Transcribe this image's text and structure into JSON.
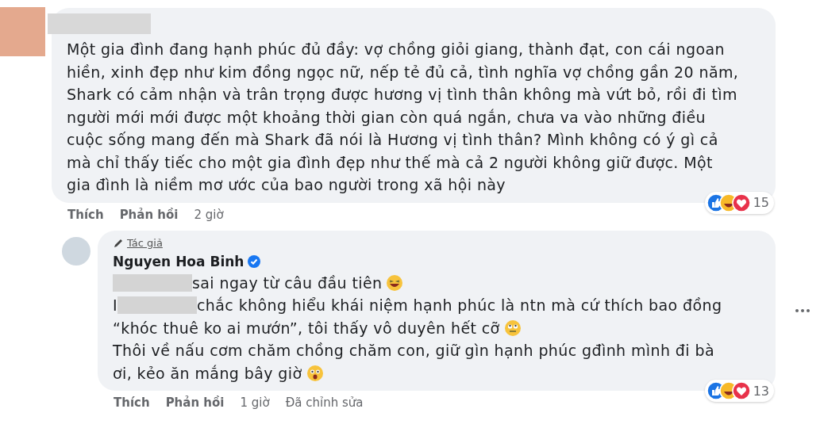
{
  "comments": [
    {
      "lines": [
        [
          {
            "kind": "text",
            "text": "Một gia đình đang hạnh phúc đủ đầy: vợ chồng giỏi giang, thành đạt, con cái ngoan"
          }
        ],
        [
          {
            "kind": "text",
            "text": "hiền, xinh đẹp như kim đồng ngọc nữ, nếp tẻ đủ cả, tình nghĩa vợ chồng gần 20 năm,"
          }
        ],
        [
          {
            "kind": "text",
            "text": "Shark có cảm nhận và trân trọng được hương vị tình thân không mà vứt bỏ, rồi đi tìm"
          }
        ],
        [
          {
            "kind": "text",
            "text": "người mới mới được một khoảng thời gian còn quá ngắn, chưa va vào những điều"
          }
        ],
        [
          {
            "kind": "text",
            "text": "cuộc sống mang đến mà Shark đã nói là Hương vị tình thân? Mình không có ý gì cả"
          }
        ],
        [
          {
            "kind": "text",
            "text": "mà chỉ thấy tiếc cho một gia đình đẹp như thế mà cả 2 người không giữ được. Một"
          }
        ],
        [
          {
            "kind": "text",
            "text": "gia đình là niềm mơ ước của bao người trong xã hội này"
          }
        ]
      ],
      "actions": [
        "Thích",
        "Phản hồi"
      ],
      "time": "2 giờ",
      "reaction_count": "15"
    },
    {
      "badge": "Tác giả",
      "author": "Nguyen Hoa Binh",
      "verified": true,
      "lines": [
        [
          {
            "kind": "redacted"
          },
          {
            "kind": "text",
            "text": "sai ngay từ câu đầu tiên"
          },
          {
            "kind": "emoji-laugh"
          }
        ],
        [
          {
            "kind": "redacted-initial",
            "text": "I"
          },
          {
            "kind": "redacted"
          },
          {
            "kind": "text",
            "text": "chắc không hiểu khái niệm hạnh phúc là ntn mà cứ thích bao đồng"
          }
        ],
        [
          {
            "kind": "text",
            "text": "“khóc thuê ko ai mướn”, tôi thấy vô duyên hết cỡ"
          },
          {
            "kind": "emoji-dizzy"
          }
        ],
        [
          {
            "kind": "text",
            "text": "Thôi về nấu cơm chăm chồng chăm con, giữ gìn hạnh phúc gđình mình đi bà"
          }
        ],
        [
          {
            "kind": "text",
            "text": "ơi, kẻo ăn mắng bây giờ"
          },
          {
            "kind": "emoji-shocked"
          }
        ]
      ],
      "actions": [
        "Thích",
        "Phản hồi"
      ],
      "time": "1 giờ",
      "edited": "Đã chỉnh sửa",
      "reaction_count": "13",
      "more": true
    }
  ]
}
